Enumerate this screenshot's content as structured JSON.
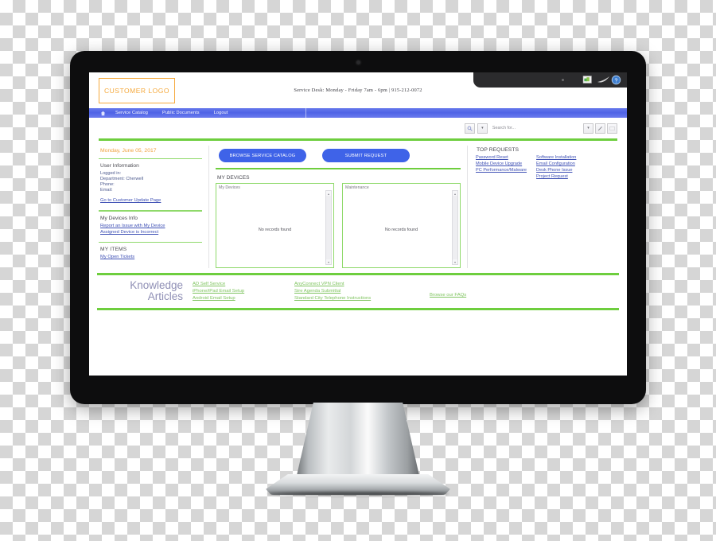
{
  "window": {
    "chrome_icons": [
      "image-icon",
      "swoosh-icon",
      "help-icon"
    ]
  },
  "header": {
    "logo_text": "CUSTOMER LOGO",
    "service_desk": "Service Desk: Monday - Friday 7am - 6pm | 915-212-0072"
  },
  "nav": {
    "home_icon": "home-icon",
    "items": [
      {
        "label": "Service Catalog"
      },
      {
        "label": "Public Documents"
      },
      {
        "label": "Logout"
      }
    ]
  },
  "search": {
    "icon": "search-icon",
    "dropdown_icon": "chevron-down-icon",
    "placeholder": "Search for...",
    "tools": [
      {
        "name": "print-icon",
        "glyph": "⬜"
      },
      {
        "name": "attachment-icon",
        "glyph": "✐"
      },
      {
        "name": "window-icon",
        "glyph": "▭"
      }
    ]
  },
  "sidebar": {
    "date": "Monday, June 05, 2017",
    "user_info_title": "User Information",
    "user_info": [
      "Logged in:",
      "Department: Cherwell",
      "Phone:",
      "Email:"
    ],
    "customer_update_link": "Go to Customer Update Page",
    "devices_title": "My Devices Info",
    "device_links": [
      "Report an Issue with My Device",
      "Assigned Device is Incorrect"
    ],
    "items_title": "MY ITEMS",
    "items_links": [
      "My Open Tickets"
    ]
  },
  "center": {
    "buttons": [
      {
        "label": "BROWSE SERVICE CATALOG"
      },
      {
        "label": "SUBMIT REQUEST"
      }
    ],
    "devices_section_title": "MY DEVICES",
    "panels": [
      {
        "caption": "My Devices",
        "empty": "No records found"
      },
      {
        "caption": "Maintenance",
        "empty": "No records found"
      }
    ]
  },
  "top_requests": {
    "title": "TOP REQUESTS",
    "column_left": [
      "Password Reset",
      "Mobile Device Upgrade",
      "PC Performance/Malware"
    ],
    "column_right": [
      "Software Installation",
      "Email Configuration",
      "Desk Phone Issue",
      "Project Request"
    ]
  },
  "knowledge": {
    "title_line1": "Knowledge",
    "title_line2": "Articles",
    "column1": [
      "AD Self Service",
      "iPhone/iPad Email Setup",
      "Android Email Setup"
    ],
    "column2": [
      "AnyConnect VPN Client",
      "Sire Agenda Submittal",
      "Standard City Telephone Instructions"
    ],
    "column3": [
      "Browse our FAQs"
    ]
  },
  "colors": {
    "accent_green": "#6ece3e",
    "nav_blue": "#4f63e6",
    "button_blue": "#3f63e8",
    "logo_orange": "#f5a93c",
    "link_blue": "#3f51b5",
    "ka_link_green": "#7fc45f",
    "bezel": "#0d0d0e"
  }
}
